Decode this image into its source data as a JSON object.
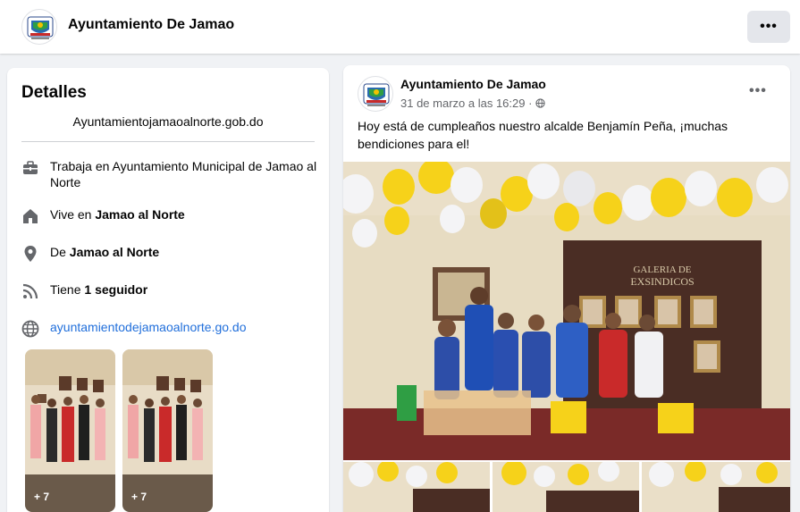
{
  "header": {
    "title": "Ayuntamiento De Jamao",
    "more_label": "•••"
  },
  "details": {
    "title": "Detalles",
    "website": "Ayuntamientojamaoalnorte.gob.do",
    "work": {
      "prefix": "Trabaja en ",
      "value": "Ayuntamiento Municipal de Jamao al Norte"
    },
    "lives": {
      "prefix": "Vive en ",
      "value": "Jamao al Norte"
    },
    "from": {
      "prefix": "De ",
      "value": "Jamao al Norte"
    },
    "followers": {
      "prefix": "Tiene ",
      "value": "1 seguidor"
    },
    "link": "ayuntamientodejamaoalnorte.go.do",
    "thumbs": [
      {
        "count": "+ 7"
      },
      {
        "count": "+ 7"
      }
    ]
  },
  "post": {
    "author": "Ayuntamiento De Jamao",
    "date": "31 de marzo a las 16:29 · ",
    "more_label": "•••",
    "text": "Hoy está de cumpleaños nuestro alcalde Benjamín Peña, ¡muchas bendiciones para el!",
    "gallery_sign": "GALERIA DE EXSINDICOS"
  },
  "icons": {
    "work": "briefcase-icon",
    "home": "home-icon",
    "location": "location-pin-icon",
    "rss": "rss-icon",
    "globe": "globe-icon",
    "audience": "globe-small-icon"
  },
  "colors": {
    "link": "#216fdb",
    "background": "#f0f2f5",
    "icon": "#65676b"
  }
}
